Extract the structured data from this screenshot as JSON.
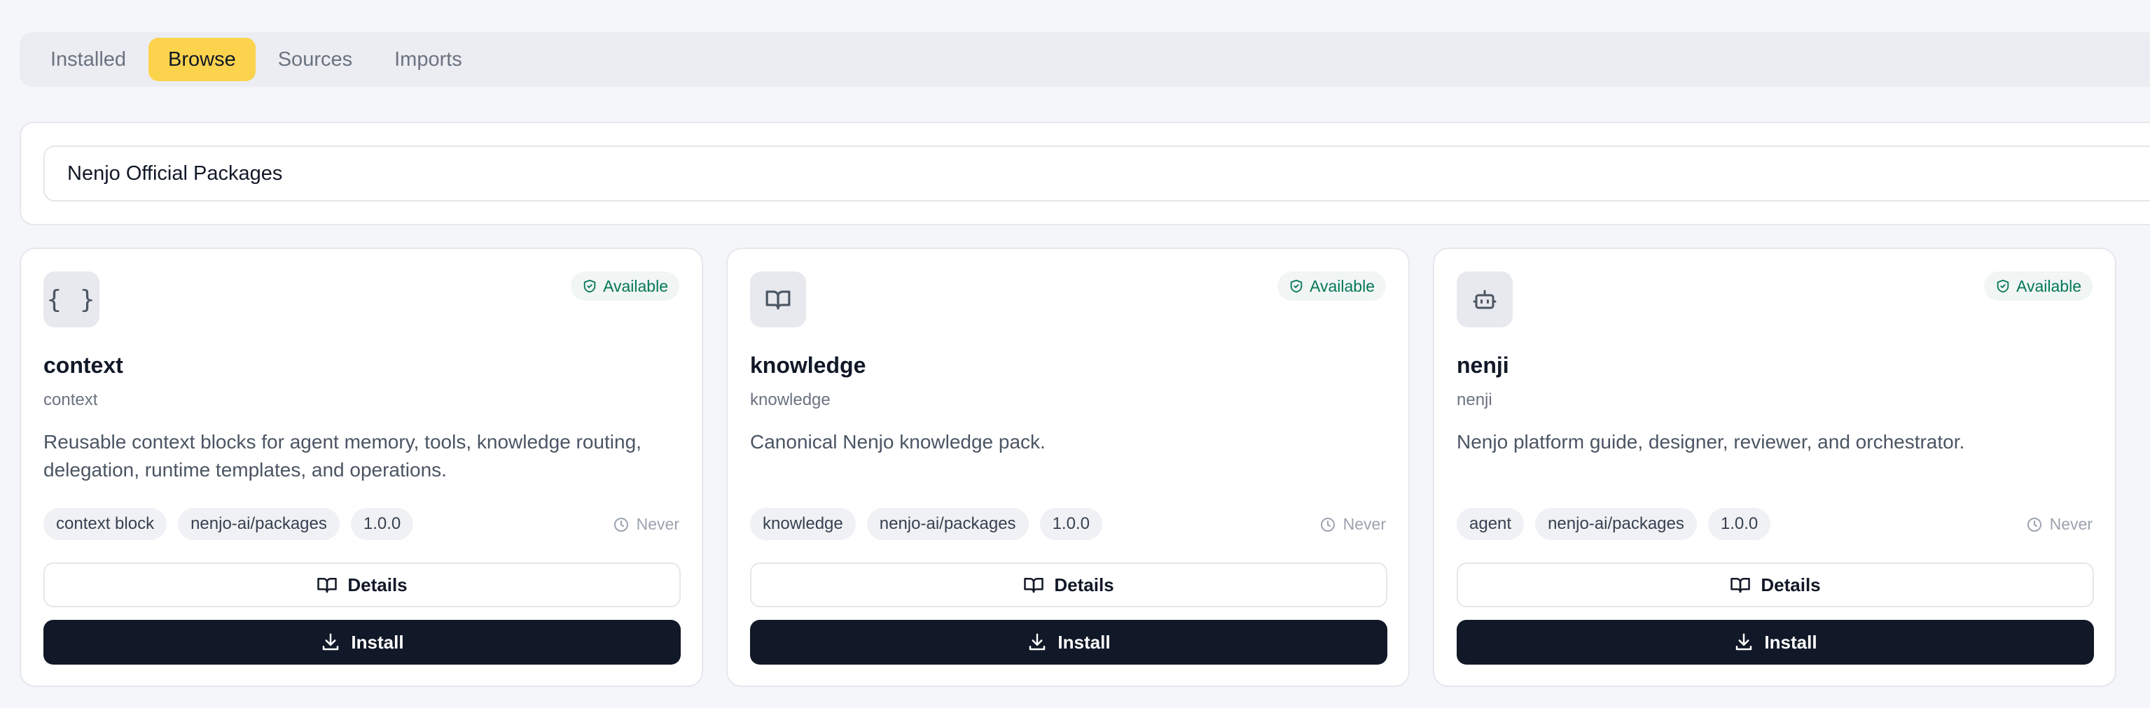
{
  "tabs": [
    {
      "label": "Installed"
    },
    {
      "label": "Browse"
    },
    {
      "label": "Sources"
    },
    {
      "label": "Imports"
    }
  ],
  "active_tab": "Browse",
  "source": {
    "selected": "Nenjo Official Packages"
  },
  "accent_color": "#fcd34d",
  "packages": [
    {
      "icon": "braces-icon",
      "status": "Available",
      "name": "context",
      "slug": "context",
      "description": "Reusable context blocks for agent memory, tools, knowledge routing, delegation, runtime templates, and operations.",
      "tags": [
        "context block",
        "nenjo-ai/packages",
        "1.0.0"
      ],
      "updated": "Never",
      "details_label": "Details",
      "install_label": "Install"
    },
    {
      "icon": "book-open-icon",
      "status": "Available",
      "name": "knowledge",
      "slug": "knowledge",
      "description": "Canonical Nenjo knowledge pack.",
      "tags": [
        "knowledge",
        "nenjo-ai/packages",
        "1.0.0"
      ],
      "updated": "Never",
      "details_label": "Details",
      "install_label": "Install"
    },
    {
      "icon": "bot-icon",
      "status": "Available",
      "name": "nenji",
      "slug": "nenji",
      "description": "Nenjo platform guide, designer, reviewer, and orchestrator.",
      "tags": [
        "agent",
        "nenjo-ai/packages",
        "1.0.0"
      ],
      "updated": "Never",
      "details_label": "Details",
      "install_label": "Install"
    }
  ]
}
